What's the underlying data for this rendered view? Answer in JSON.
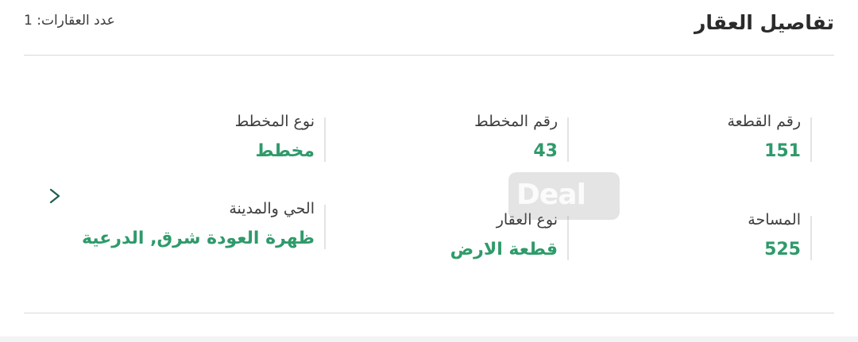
{
  "header": {
    "title": "تفاصيل العقار",
    "count_text": "عدد العقارات: 1"
  },
  "fields": {
    "plot_number": {
      "label": "رقم القطعة",
      "value": "151"
    },
    "plan_number": {
      "label": "رقم المخطط",
      "value": "43"
    },
    "plan_type": {
      "label": "نوع المخطط",
      "value": "مخطط"
    },
    "area": {
      "label": "المساحة",
      "value": "525"
    },
    "property_type": {
      "label": "نوع العقار",
      "value": "قطعة الارض"
    },
    "district_city": {
      "label": "الحي والمدينة",
      "value": "ظهرة العودة شرق, الدرعية"
    }
  },
  "watermark": {
    "text": "Deal"
  },
  "icons": {
    "next": "chevron-right-icon"
  },
  "colors": {
    "value_green": "#2f9a6a",
    "label_text": "#3d3d3d",
    "divider": "#d9d9d9"
  }
}
